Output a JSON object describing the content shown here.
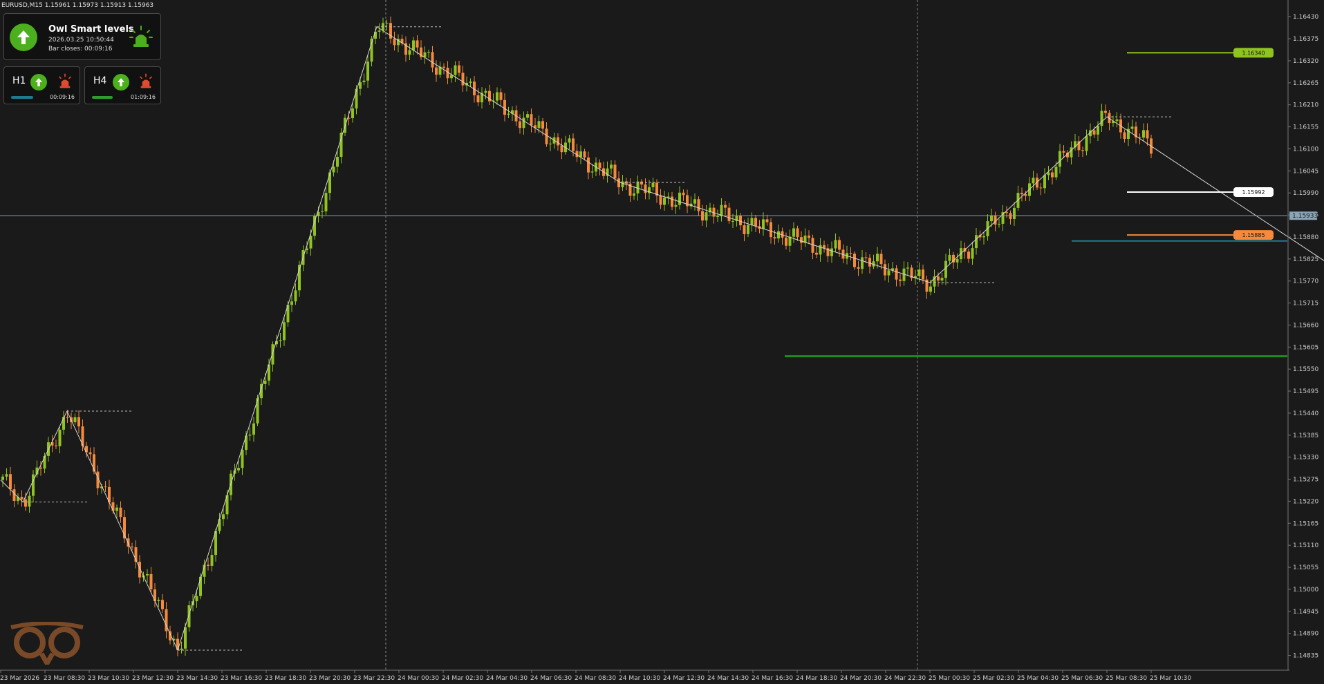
{
  "window": {
    "header": "EURUSD,M15  1.15961 1.15973 1.15913 1.15963"
  },
  "indicator": {
    "title": "Owl Smart levels",
    "datetime": "2026.03.25 10:50:44",
    "bar_closes": "Bar closes: 00:09:16",
    "direction": "up",
    "alert": "on",
    "h1": {
      "label": "H1",
      "time": "00:09:16",
      "direction": "up",
      "alert": "off"
    },
    "h4": {
      "label": "H4",
      "time": "01:09:16",
      "direction": "up",
      "alert": "off"
    }
  },
  "chart_data": {
    "type": "candlestick",
    "symbol": "EURUSD",
    "timeframe": "M15",
    "ylim": [
      1.14798,
      1.16458
    ],
    "y_ticks": [
      "1.16430",
      "1.16375",
      "1.16320",
      "1.16265",
      "1.16210",
      "1.16155",
      "1.16100",
      "1.16045",
      "1.15990",
      "1.15935",
      "1.15880",
      "1.15825",
      "1.15770",
      "1.15715",
      "1.15660",
      "1.15605",
      "1.15550",
      "1.15495",
      "1.15440",
      "1.15385",
      "1.15330",
      "1.15275",
      "1.15220",
      "1.15165",
      "1.15110",
      "1.15055",
      "1.15000",
      "1.14945",
      "1.14890",
      "1.14835"
    ],
    "x_ticks": [
      "23 Mar 2026",
      "23 Mar 08:30",
      "23 Mar 10:30",
      "23 Mar 12:30",
      "23 Mar 14:30",
      "23 Mar 16:30",
      "23 Mar 18:30",
      "23 Mar 20:30",
      "23 Mar 22:30",
      "24 Mar 00:30",
      "24 Mar 02:30",
      "24 Mar 04:30",
      "24 Mar 06:30",
      "24 Mar 08:30",
      "24 Mar 10:30",
      "24 Mar 12:30",
      "24 Mar 14:30",
      "24 Mar 16:30",
      "24 Mar 18:30",
      "24 Mar 20:30",
      "24 Mar 22:30",
      "25 Mar 00:30",
      "25 Mar 02:30",
      "25 Mar 04:30",
      "25 Mar 06:30",
      "25 Mar 08:30",
      "25 Mar 10:30"
    ],
    "current_price": "1.15933",
    "levels": [
      {
        "label": "1.16340",
        "value": 1.1634,
        "color": "#8fc320"
      },
      {
        "label": "1.15992",
        "value": 1.15992,
        "color": "#ffffff"
      },
      {
        "label": "1.15885",
        "value": 1.15885,
        "color": "#f58a3c"
      }
    ],
    "support_line": 1.15582,
    "zigzag": [
      [
        0,
        1.15273
      ],
      [
        0.5,
        1.15218
      ],
      [
        1.5,
        1.15445
      ],
      [
        4,
        1.14848
      ],
      [
        8.5,
        1.16405
      ],
      [
        14,
        1.16016
      ],
      [
        21,
        1.15766
      ],
      [
        25,
        1.1618
      ],
      [
        30,
        1.15814
      ],
      [
        34.5,
        1.15583
      ],
      [
        41,
        1.16316
      ],
      [
        46,
        1.15871
      ],
      [
        48,
        1.1617
      ],
      [
        48.5,
        1.1602
      ]
    ],
    "colors": {
      "bull": "#8fc320",
      "bear": "#f58a3c",
      "background": "#1a1a1a"
    }
  }
}
